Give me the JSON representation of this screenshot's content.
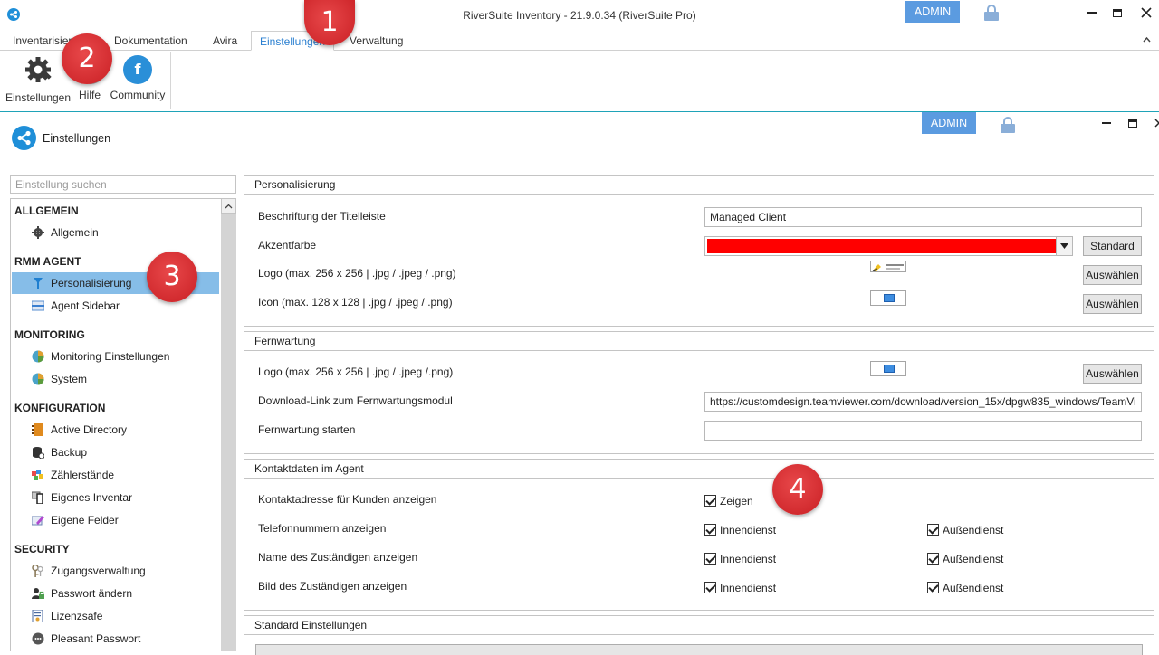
{
  "window": {
    "title": "RiverSuite Inventory - 21.9.0.34 (RiverSuite Pro)",
    "admin_label": "ADMIN"
  },
  "ribbon": {
    "tabs": [
      "Inventarisierung",
      "Dokumentation",
      "Avira",
      "Einstellungen",
      "Verwaltung"
    ],
    "active_tab": "Einstellungen",
    "buttons": {
      "settings": "Einstellungen",
      "help": "Hilfe",
      "community": "Community",
      "facebook_glyph": "f"
    }
  },
  "inner": {
    "admin_label": "ADMIN",
    "page_title": "Einstellungen",
    "search_placeholder": "Einstellung suchen"
  },
  "tree": {
    "cat_general": "ALLGEMEIN",
    "item_general": "Allgemein",
    "cat_rmm": "RMM AGENT",
    "item_personalization": "Personalisierung",
    "item_agent_sidebar": "Agent Sidebar",
    "cat_monitoring": "MONITORING",
    "item_monitoring_settings": "Monitoring Einstellungen",
    "item_system": "System",
    "cat_configuration": "KONFIGURATION",
    "item_active_directory": "Active Directory",
    "item_backup": "Backup",
    "item_counters": "Zählerstände",
    "item_own_inventory": "Eigenes Inventar",
    "item_own_fields": "Eigene Felder",
    "cat_security": "SECURITY",
    "item_access_management": "Zugangsverwaltung",
    "item_change_password": "Passwort ändern",
    "item_license_safe": "Lizenzsafe",
    "item_pleasant_password": "Pleasant Passwort"
  },
  "personalization": {
    "header": "Personalisierung",
    "titlebar_label": "Beschriftung der Titelleiste",
    "titlebar_value": "Managed Client",
    "accent_label": "Akzentfarbe",
    "accent_color": "#ff0000",
    "accent_button": "Standard",
    "logo_label": "Logo (max. 256 x 256 | .jpg / .jpeg / .png)",
    "logo_button": "Auswählen",
    "icon_label": "Icon (max. 128 x 128 | .jpg / .jpeg / .png)",
    "icon_button": "Auswählen"
  },
  "remote": {
    "header": "Fernwartung",
    "logo_label": "Logo (max. 256 x 256 | .jpg / .jpeg /.png)",
    "logo_button": "Auswählen",
    "download_label": "Download-Link zum Fernwartungsmodul",
    "download_value": "https://customdesign.teamviewer.com/download/version_15x/dpgw835_windows/TeamVi",
    "start_label": "Fernwartung starten",
    "start_value": ""
  },
  "contact": {
    "header": "Kontaktdaten im Agent",
    "address_label": "Kontaktadresse für Kunden anzeigen",
    "address_check": "Zeigen",
    "phone_label": "Telefonnummern anzeigen",
    "name_label": "Name des Zuständigen anzeigen",
    "image_label": "Bild des Zuständigen anzeigen",
    "inside": "Innendienst",
    "outside": "Außendienst"
  },
  "standard": {
    "header": "Standard Einstellungen"
  },
  "markers": [
    "1",
    "2",
    "3",
    "4"
  ]
}
